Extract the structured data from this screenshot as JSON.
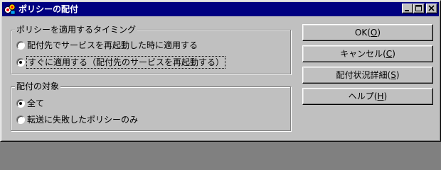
{
  "window": {
    "title": "ポリシーの配付"
  },
  "timing_group": {
    "label": "ポリシーを適用するタイミング",
    "options": [
      {
        "label": "配付先でサービスを再起動した時に適用する",
        "checked": false
      },
      {
        "label": "すぐに適用する（配付先のサービスを再起動する）",
        "checked": true
      }
    ]
  },
  "target_group": {
    "label": "配付の対象",
    "options": [
      {
        "label": "全て",
        "checked": true
      },
      {
        "label": "転送に失敗したポリシーのみ",
        "checked": false
      }
    ]
  },
  "buttons": {
    "ok": {
      "label": "OK(",
      "accel": "O",
      "end": ")"
    },
    "cancel": {
      "label": "キャンセル(",
      "accel": "C",
      "end": ")"
    },
    "detail": {
      "label": "配付状況詳細(",
      "accel": "S",
      "end": ")"
    },
    "help": {
      "label": "ヘルプ(",
      "accel": "H",
      "end": ")"
    }
  }
}
